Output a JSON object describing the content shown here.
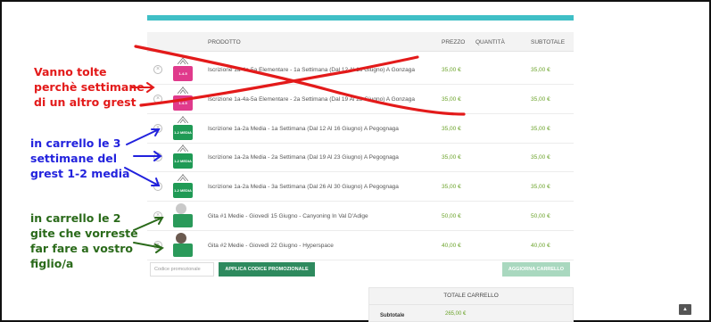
{
  "cart": {
    "columns": {
      "product": "PRODOTTO",
      "price": "PREZZO",
      "quantity": "QUANTITÀ",
      "subtotal": "SUBTOTALE"
    },
    "rows": [
      {
        "name": "Iscrizione 1a-4a-5a Elementare - 1a Settimana (Dal 12 Al 16 Giugno) A Gonzaga",
        "price": "35,00 €",
        "subtotal": "35,00 €",
        "badge_color": "#e03a8c",
        "badge_text": "1-4-5 ELEMENTARE"
      },
      {
        "name": "Iscrizione 1a-4a-5a Elementare - 2a Settimana (Dal 19 Al 23 Giugno) A Gonzaga",
        "price": "35,00 €",
        "subtotal": "35,00 €",
        "badge_color": "#e03a8c",
        "badge_text": "1-4-5 ELEMENTARE"
      },
      {
        "name": "Iscrizione 1a-2a Media - 1a Settimana (Dal 12 Al 16 Giugno) A Pegognaga",
        "price": "35,00 €",
        "subtotal": "35,00 €",
        "badge_color": "#1f9a55",
        "badge_text": "1-2 MEDIA"
      },
      {
        "name": "Iscrizione 1a-2a Media - 2a Settimana (Dal 19 Al 23 Giugno) A Pegognaga",
        "price": "35,00 €",
        "subtotal": "35,00 €",
        "badge_color": "#1f9a55",
        "badge_text": "1-2 MEDIA"
      },
      {
        "name": "Iscrizione 1a-2a Media - 3a Settimana (Dal 26 Al 30 Giugno) A Pegognaga",
        "price": "35,00 €",
        "subtotal": "35,00 €",
        "badge_color": "#1f9a55",
        "badge_text": "1-2 MEDIA"
      },
      {
        "name": "Gita #1 Medie - Giovedì 15 Giugno - Canyoning In Val D'Adige",
        "price": "50,00 €",
        "subtotal": "50,00 €",
        "badge_color": "#2a9a5a",
        "badge_text": ""
      },
      {
        "name": "Gita #2 Medie - Giovedì 22 Giugno - Hyperspace",
        "price": "40,00 €",
        "subtotal": "40,00 €",
        "badge_color": "#2a9a5a",
        "badge_text": ""
      }
    ],
    "coupon_placeholder": "Codice promozionale",
    "apply_coupon_label": "APPLICA CODICE PROMOZIONALE",
    "update_cart_label": "AGGIORNA CARRELLO"
  },
  "totals": {
    "title": "TOTALE CARRELLO",
    "subtotal_label": "Subtotale",
    "subtotal_value": "265,00 €"
  },
  "annotations": {
    "red": "Vanno tolte\nperchè settimane\ndi un altro grest",
    "blue": "in carrello le 3\nsettimane del\ngrest 1-2 media",
    "green": "in carrello le 2\ngite che vorreste\nfar fare a vostro\nfiglio/a"
  },
  "colors": {
    "accent_teal": "#3fbfc6",
    "price_green": "#6ba32a",
    "button_green": "#2e8a5e",
    "annotation_red": "#e31a1a",
    "annotation_blue": "#2222dd",
    "annotation_green": "#2a6a1a"
  },
  "icons": {
    "remove": "remove-icon",
    "scroll_top": "arrow-up-icon",
    "tent": "tent-icon"
  }
}
